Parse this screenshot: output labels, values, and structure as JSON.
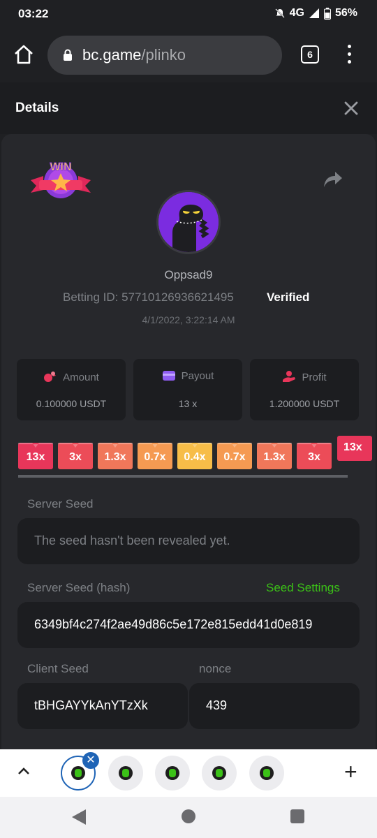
{
  "status_bar": {
    "time": "03:22",
    "network": "4G",
    "battery": "56%"
  },
  "browser": {
    "url_domain": "bc.game",
    "url_path": "/plinko",
    "tab_count": "6"
  },
  "details": {
    "title": "Details"
  },
  "bet": {
    "username": "Oppsad9",
    "betting_id_label": "Betting ID: 57710126936621495",
    "verified": "Verified",
    "datetime": "4/1/2022, 3:22:14 AM"
  },
  "stats": [
    {
      "label": "Amount",
      "value": "0.100000 USDT",
      "icon": "coins-icon"
    },
    {
      "label": "Payout",
      "value": "13 x",
      "icon": "wallet-icon"
    },
    {
      "label": "Profit",
      "value": "1.200000 USDT",
      "icon": "profit-hand-icon"
    }
  ],
  "multipliers": [
    {
      "label": "13x",
      "color": "#e8365a"
    },
    {
      "label": "3x",
      "color": "#ec4c58"
    },
    {
      "label": "1.3x",
      "color": "#f0775a"
    },
    {
      "label": "0.7x",
      "color": "#f59a52"
    },
    {
      "label": "0.4x",
      "color": "#f7bd48"
    },
    {
      "label": "0.7x",
      "color": "#f59a52"
    },
    {
      "label": "1.3x",
      "color": "#f0775a"
    },
    {
      "label": "3x",
      "color": "#ec4c58"
    }
  ],
  "multiplier_highlight": "13x",
  "server_seed": {
    "label": "Server Seed",
    "value": "The seed hasn't been revealed yet."
  },
  "server_seed_hash": {
    "label": "Server Seed (hash)",
    "link": "Seed Settings",
    "value": "6349bf4c274f2ae49d86c5e172e815edd41d0e819"
  },
  "client_seed": {
    "label": "Client Seed",
    "value": "tBHGAYYkAnYTzXk"
  },
  "nonce": {
    "label": "nonce",
    "value": "439"
  },
  "colors": {
    "accent_green": "#3bc117",
    "panel": "#27282c",
    "tab_active": "#1f64b6"
  }
}
